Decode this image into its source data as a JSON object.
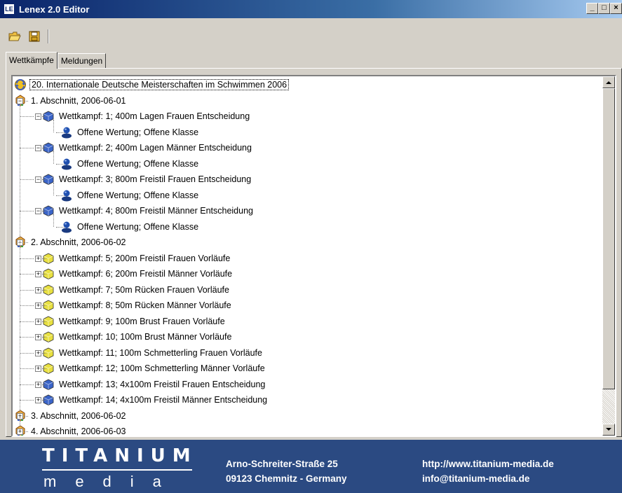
{
  "window": {
    "title": "Lenex 2.0 Editor",
    "app_icon_text": "LE",
    "buttons": [
      "_",
      "□",
      "×"
    ]
  },
  "toolbar": {
    "items": [
      "open-folder-icon",
      "save-icon"
    ]
  },
  "tabs": [
    {
      "label": "Wettkämpfe",
      "active": true
    },
    {
      "label": "Meldungen",
      "active": false
    }
  ],
  "tree": {
    "root": "20. Internationale Deutsche Meisterschaften im Schwimmen 2006",
    "sessions": [
      {
        "label": "1. Abschnitt, 2006-06-01",
        "expanded": true,
        "events": [
          {
            "label": "Wettkampf: 1; 400m Lagen Frauen Entscheidung",
            "type": "final",
            "expanded": true,
            "children": [
              "Offene Wertung; Offene Klasse"
            ]
          },
          {
            "label": "Wettkampf: 2; 400m Lagen Männer Entscheidung",
            "type": "final",
            "expanded": true,
            "children": [
              "Offene Wertung; Offene Klasse"
            ]
          },
          {
            "label": "Wettkampf: 3; 800m Freistil Frauen Entscheidung",
            "type": "final",
            "expanded": true,
            "children": [
              "Offene Wertung; Offene Klasse"
            ]
          },
          {
            "label": "Wettkampf: 4; 800m Freistil Männer Entscheidung",
            "type": "final",
            "expanded": true,
            "children": [
              "Offene Wertung; Offene Klasse"
            ]
          }
        ]
      },
      {
        "label": "2. Abschnitt, 2006-06-02",
        "expanded": true,
        "events": [
          {
            "label": "Wettkampf: 5; 200m Freistil Frauen Vorläufe",
            "type": "prelim",
            "expanded": false
          },
          {
            "label": "Wettkampf: 6; 200m Freistil Männer Vorläufe",
            "type": "prelim",
            "expanded": false
          },
          {
            "label": "Wettkampf: 7; 50m Rücken Frauen Vorläufe",
            "type": "prelim",
            "expanded": false
          },
          {
            "label": "Wettkampf: 8; 50m Rücken Männer Vorläufe",
            "type": "prelim",
            "expanded": false
          },
          {
            "label": "Wettkampf: 9; 100m Brust Frauen Vorläufe",
            "type": "prelim",
            "expanded": false
          },
          {
            "label": "Wettkampf: 10; 100m Brust Männer Vorläufe",
            "type": "prelim",
            "expanded": false
          },
          {
            "label": "Wettkampf: 11; 100m Schmetterling Frauen Vorläufe",
            "type": "prelim",
            "expanded": false
          },
          {
            "label": "Wettkampf: 12; 100m Schmetterling Männer Vorläufe",
            "type": "prelim",
            "expanded": false
          },
          {
            "label": "Wettkampf: 13; 4x100m Freistil Frauen Entscheidung",
            "type": "final",
            "expanded": false
          },
          {
            "label": "Wettkampf: 14; 4x100m Freistil Männer Entscheidung",
            "type": "final",
            "expanded": false
          }
        ]
      },
      {
        "label": "3. Abschnitt, 2006-06-02",
        "expanded": false,
        "events": []
      },
      {
        "label": "4. Abschnitt, 2006-06-03",
        "expanded": false,
        "events": []
      }
    ]
  },
  "footer": {
    "logo_top": "TITANIUM",
    "logo_bottom": "media",
    "address_line1": "Arno-Schreiter-Straße 25",
    "address_line2": "09123 Chemnitz - Germany",
    "web": "http://www.titanium-media.de",
    "email": "info@titanium-media.de"
  },
  "colors": {
    "titlebar": "#0a246a",
    "footer": "#2b4a82",
    "final_cube": "#3a64c8",
    "prelim_cube": "#e8e040"
  }
}
